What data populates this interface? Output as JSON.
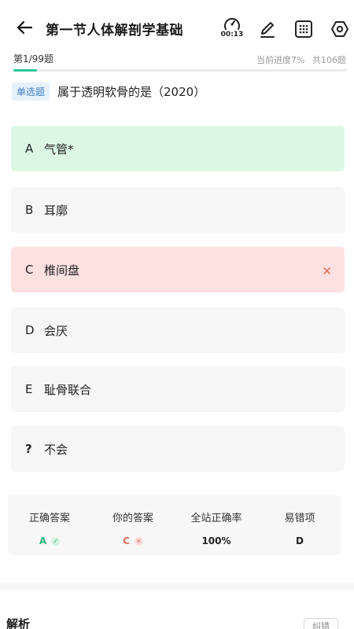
{
  "header": {
    "title": "第一节人体解剖学基础",
    "timer": "00:13"
  },
  "progress": {
    "index": "第1/99题",
    "current_label": "当前进度7%",
    "total_label": "共106题",
    "percent": 7
  },
  "question": {
    "type": "单选题",
    "text": "属于透明软骨的是（2020）"
  },
  "options": [
    {
      "letter": "A",
      "text": "气管*",
      "state": "correct"
    },
    {
      "letter": "B",
      "text": "耳廓",
      "state": "normal"
    },
    {
      "letter": "C",
      "text": "椎间盘",
      "state": "wrong"
    },
    {
      "letter": "D",
      "text": "会厌",
      "state": "normal"
    },
    {
      "letter": "E",
      "text": "耻骨联合",
      "state": "normal"
    },
    {
      "letter": "?",
      "text": "不会",
      "state": "normal"
    }
  ],
  "answer": {
    "correct_label": "正确答案",
    "correct_value": "A",
    "yours_label": "你的答案",
    "yours_value": "C",
    "rate_label": "全站正确率",
    "rate_value": "100%",
    "error_label": "易错项",
    "error_value": "D"
  },
  "analysis": {
    "title": "解析",
    "report_label": "纠错"
  },
  "colors": {
    "accent": "#27c69a",
    "correct_bg": "#dcf8e5",
    "wrong_bg": "#fde1e1",
    "wrong_mark": "#e06b5a"
  },
  "icons": [
    "back-arrow-icon",
    "timer-icon",
    "edit-icon",
    "grid-icon",
    "settings-icon",
    "close-icon",
    "check-icon"
  ]
}
